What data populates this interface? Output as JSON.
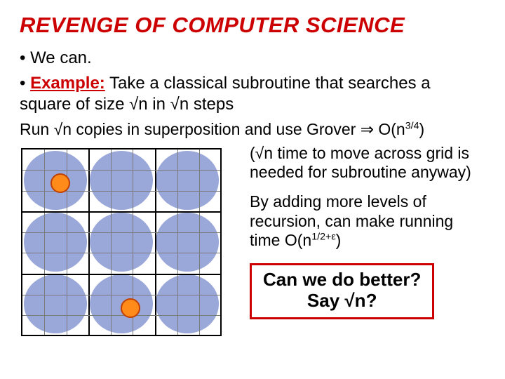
{
  "title": "REVENGE OF COMPUTER SCIENCE",
  "bullet1": "We can.",
  "bullet2_lead": "Example:",
  "bullet2_rest_a": " Take a classical subroutine that searches a square of size ",
  "bullet2_sqrt1": "n",
  "bullet2_rest_b": " in ",
  "bullet2_sqrt2": "n",
  "bullet2_rest_c": " steps",
  "runline_a": "Run ",
  "runline_sqrt": "n",
  "runline_b": " copies in superposition and use Grover ",
  "runline_arrow": "⇒",
  "runline_c": " O(n",
  "runline_exp": "3/4",
  "runline_d": ")",
  "right_para1_a": "(",
  "right_para1_sqrt": "n",
  "right_para1_b": " time to move across grid is needed for subroutine anyway)",
  "right_para2_a": "By adding more levels of recursion, can make running time O(n",
  "right_para2_exp": "1/2+ε",
  "right_para2_b": ")",
  "box_line1": "Can we do better?",
  "box_line2_a": "Say ",
  "box_sqrt": "n",
  "box_line2_b": "?"
}
